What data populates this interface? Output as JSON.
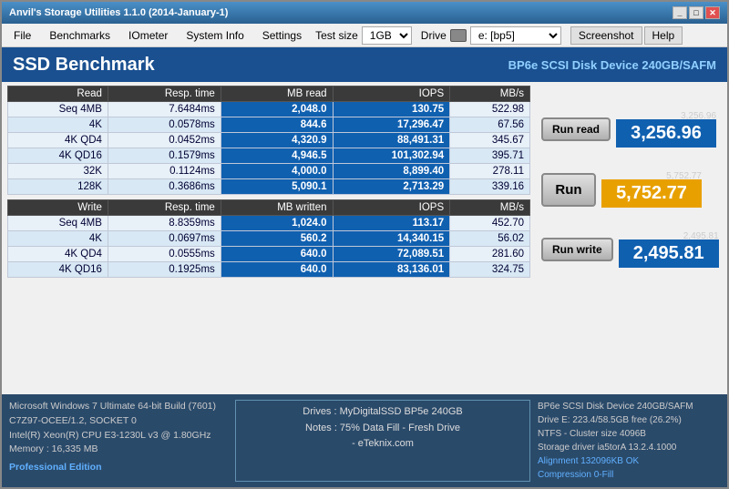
{
  "window": {
    "title": "Anvil's Storage Utilities 1.1.0 (2014-January-1)"
  },
  "menu": {
    "file": "File",
    "benchmarks": "Benchmarks",
    "iometer": "IOmeter",
    "system_info": "System Info",
    "settings": "Settings",
    "test_size_label": "Test size",
    "test_size_value": "1GB",
    "drive_label": "Drive",
    "drive_value": "e: [bp5]",
    "screenshot": "Screenshot",
    "help": "Help"
  },
  "header": {
    "title": "SSD Benchmark",
    "device": "BP6e  SCSI Disk Device 240GB/SAFM"
  },
  "read_table": {
    "headers": [
      "Read",
      "Resp. time",
      "MB read",
      "IOPS",
      "MB/s"
    ],
    "rows": [
      {
        "label": "Seq 4MB",
        "resp": "7.6484ms",
        "mb": "2,048.0",
        "iops": "130.75",
        "mbs": "522.98"
      },
      {
        "label": "4K",
        "resp": "0.0578ms",
        "mb": "844.6",
        "iops": "17,296.47",
        "mbs": "67.56"
      },
      {
        "label": "4K QD4",
        "resp": "0.0452ms",
        "mb": "4,320.9",
        "iops": "88,491.31",
        "mbs": "345.67"
      },
      {
        "label": "4K QD16",
        "resp": "0.1579ms",
        "mb": "4,946.5",
        "iops": "101,302.94",
        "mbs": "395.71"
      },
      {
        "label": "32K",
        "resp": "0.1124ms",
        "mb": "4,000.0",
        "iops": "8,899.40",
        "mbs": "278.11"
      },
      {
        "label": "128K",
        "resp": "0.3686ms",
        "mb": "5,090.1",
        "iops": "2,713.29",
        "mbs": "339.16"
      }
    ]
  },
  "write_table": {
    "headers": [
      "Write",
      "Resp. time",
      "MB written",
      "IOPS",
      "MB/s"
    ],
    "rows": [
      {
        "label": "Seq 4MB",
        "resp": "8.8359ms",
        "mb": "1,024.0",
        "iops": "113.17",
        "mbs": "452.70"
      },
      {
        "label": "4K",
        "resp": "0.0697ms",
        "mb": "560.2",
        "iops": "14,340.15",
        "mbs": "56.02"
      },
      {
        "label": "4K QD4",
        "resp": "0.0555ms",
        "mb": "640.0",
        "iops": "72,089.51",
        "mbs": "281.60"
      },
      {
        "label": "4K QD16",
        "resp": "0.1925ms",
        "mb": "640.0",
        "iops": "83,136.01",
        "mbs": "324.75"
      }
    ]
  },
  "scores": {
    "run_read_label": "Run read",
    "run_label": "Run",
    "run_write_label": "Run write",
    "read_score_mini": "3,256.96",
    "read_score": "3,256.96",
    "main_score_mini": "5,752.77",
    "main_score": "5,752.77",
    "write_score_mini": "2,495.81",
    "write_score": "2,495.81"
  },
  "bottom": {
    "sys_line1": "Microsoft Windows 7 Ultimate  64-bit Build (7601)",
    "sys_line2": "C7Z97-OCEE/1.2, SOCKET 0",
    "sys_line3": "Intel(R) Xeon(R) CPU E3-1230L v3 @ 1.80GHz",
    "sys_line4": "Memory : 16,335 MB",
    "pro_edition": "Professional Edition",
    "notes_line1": "Drives : MyDigitalSSD BP5e 240GB",
    "notes_line2": "Notes : 75% Data Fill - Fresh Drive",
    "notes_line3": "- eTeknix.com",
    "drive_line1": "BP6e  SCSI Disk Device 240GB/SAFM",
    "drive_line2": "Drive E: 223.4/58.5GB free (26.2%)",
    "drive_line3": "NTFS - Cluster size 4096B",
    "drive_line4": "Storage driver  ia5torA 13.2.4.1000",
    "drive_line5": "Alignment 132096KB OK",
    "drive_line6": "Compression 0-Fill"
  }
}
